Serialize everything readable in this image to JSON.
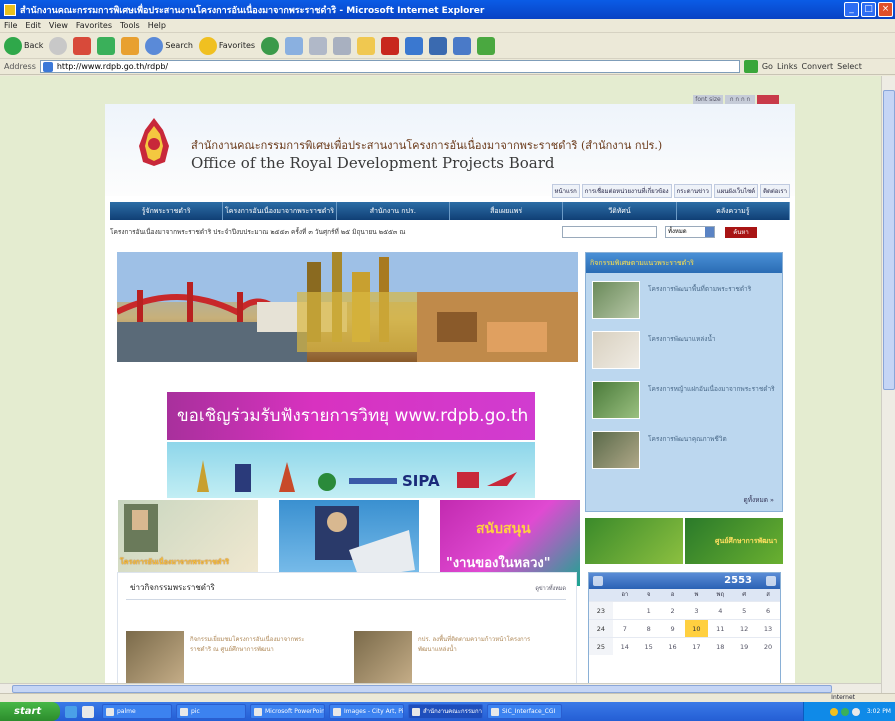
{
  "window": {
    "title": "สำนักงานคณะกรรมการพิเศษเพื่อประสานงานโครงการอันเนื่องมาจากพระราชดำริ - Microsoft Internet Explorer",
    "minimize": "_",
    "maximize": "□",
    "close": "×"
  },
  "menu": [
    "File",
    "Edit",
    "View",
    "Favorites",
    "Tools",
    "Help"
  ],
  "toolbar": {
    "back": "Back",
    "search": "Search",
    "favorites": "Favorites"
  },
  "address": {
    "label": "Address",
    "url": "http://www.rdpb.go.th/rdpb/",
    "go": "Go",
    "links": "Links",
    "convert": "Convert",
    "select": "Select"
  },
  "page": {
    "org_th": "สำนักงานคณะกรรมการพิเศษเพื่อประสานงานโครงการอันเนื่องมาจากพระราชดำริ (สำนักงาน กปร.)",
    "org_en": "Office of the Royal Development Projects Board",
    "fontsize": [
      "font size",
      "ก ก ก ก"
    ],
    "top_links": [
      "หน้าแรก",
      "การเชื่อมต่อหน่วยงานที่เกี่ยวข้อง",
      "กระดานข่าว",
      "แผนผังเว็บไซต์",
      "ติดต่อเรา"
    ],
    "nav": [
      "รู้จักพระราชดำริ",
      "โครงการอันเนื่องมาจากพระราชดำริ",
      "สำนักงาน กปร.",
      "สื่อเผยแพร่",
      "วีดิทัศน์",
      "คลังความรู้"
    ],
    "ticker": "โครงการอันเนื่องมาจากพระราชดำริ ประจำปีงบประมาณ ๒๕๕๓ ครั้งที่ ๓ วันศุกร์ที่ ๒๕ มิถุนายน ๒๕๕๓ ณ",
    "search_select": "ทั้งหมด",
    "search_button": "ค้นหา",
    "promo1_th": "ขอเชิญร่วมรับฟังรายการวิทยุ",
    "promo1_url": "www.rdpb.go.th",
    "promo2_logo": "SIPA",
    "thumb1_caption": "โครงการอันเนื่องมาจากพระราชดำริ",
    "thumb3_l1": "สนับสนุน",
    "thumb3_l2": "\"งานของในหลวง\"",
    "right_panel_title": "กิจกรรมพิเศษตามแนวพระราชดำริ",
    "right_items": [
      "โครงการพัฒนาพื้นที่ตามพระราชดำริ",
      "โครงการพัฒนาแหล่งน้ำ",
      "โครงการหญ้าแฝกอันเนื่องมาจากพระราชดำริ",
      "โครงการพัฒนาคุณภาพชีวิต"
    ],
    "right_more": "ดูทั้งหมด »",
    "green2_label": "ศูนย์ศึกษาการพัฒนา",
    "news_title": "ข่าวกิจกรรมพระราชดำริ",
    "news_more": "ดูข่าวทั้งหมด",
    "news_items": [
      "กิจกรรมเยี่ยมชมโครงการอันเนื่องมาจากพระราชดำริ ณ ศูนย์ศึกษาการพัฒนา",
      "กปร. ลงพื้นที่ติดตามความก้าวหน้าโครงการพัฒนาแหล่งน้ำ"
    ],
    "calendar": {
      "year": "2553",
      "days": [
        "อา",
        "จ",
        "อ",
        "พ",
        "พฤ",
        "ศ",
        "ส"
      ],
      "weeks": [
        [
          "23",
          "",
          "1",
          "2",
          "3",
          "4",
          "5",
          "6"
        ],
        [
          "24",
          "7",
          "8",
          "9",
          "10",
          "11",
          "12",
          "13"
        ],
        [
          "25",
          "14",
          "15",
          "16",
          "17",
          "18",
          "19",
          "20"
        ]
      ]
    }
  },
  "status": {
    "zone": "Internet"
  },
  "taskbar": {
    "start": "start",
    "tasks": [
      "palme",
      "pic",
      "Microsoft PowerPoint",
      "Images - City Art, Pi...",
      "สำนักงานคณะกรรมการ...",
      "SIC_Interface_CGI"
    ],
    "clock": "3:02 PM"
  },
  "colors": {
    "nav": "#1a4f8a",
    "accent_red": "#a81414",
    "promo_magenta": "#d832c0"
  }
}
